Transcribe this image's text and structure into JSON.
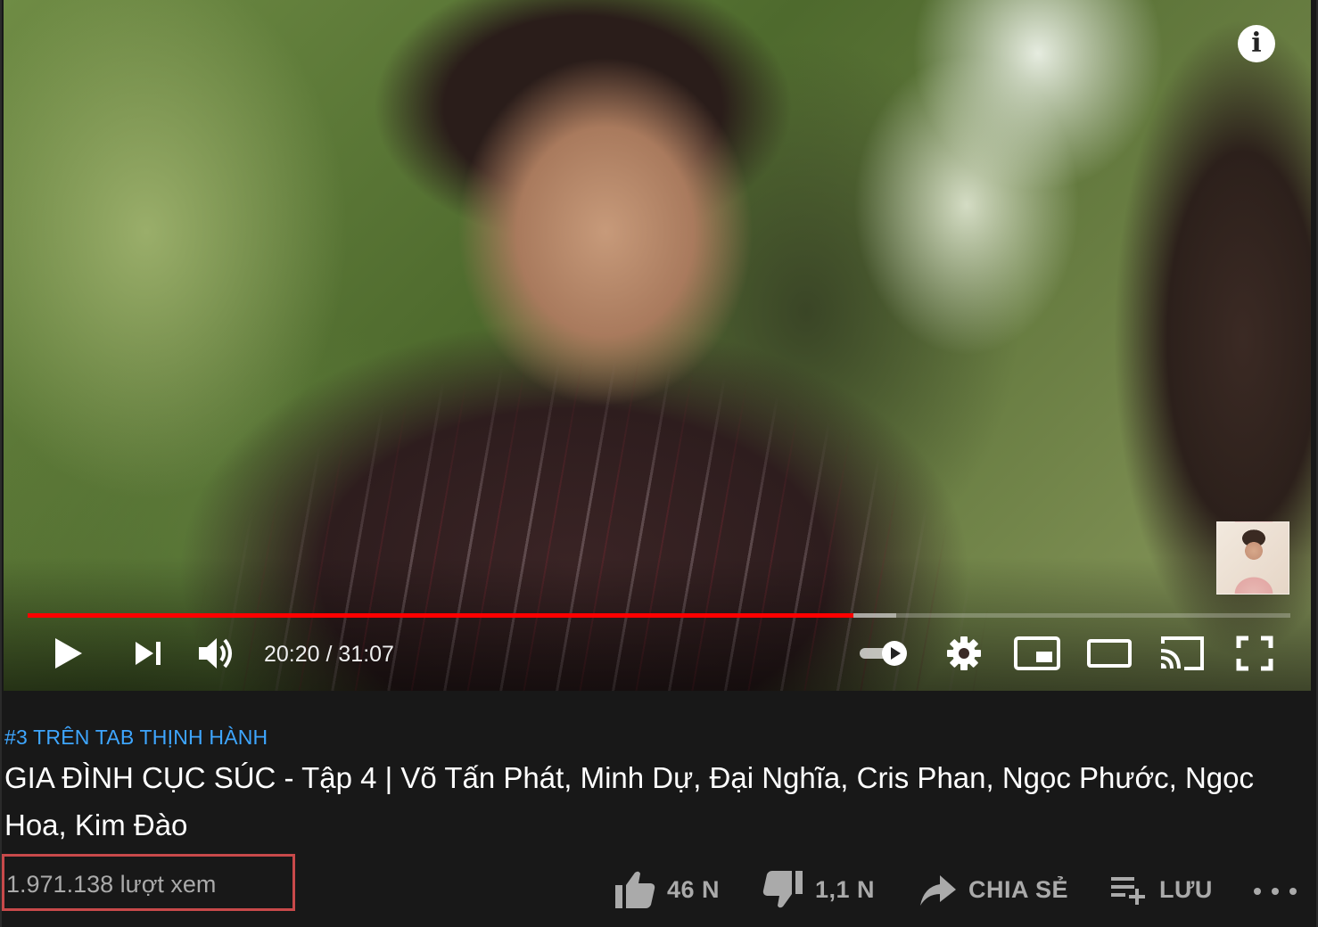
{
  "player": {
    "current_time": "20:20",
    "duration": "31:07",
    "time_display": "20:20 / 31:07",
    "progress_played_fraction": 0.654,
    "progress_buffered_fraction": 0.688,
    "autoplay": true,
    "controls": [
      "play-icon",
      "next-icon",
      "volume-icon",
      "autoplay-toggle",
      "settings-icon",
      "miniplayer-icon",
      "theater-icon",
      "cast-icon",
      "fullscreen-icon"
    ],
    "info_label": "i"
  },
  "video": {
    "hashtag": "#3 TRÊN TAB THỊNH HÀNH",
    "title": "GIA ĐÌNH CỤC SÚC - Tập 4 | Võ Tấn Phát, Minh Dự, Đại Nghĩa, Cris Phan, Ngọc Phước, Ngọc Hoa, Kim Đào",
    "views": "1.971.138 lượt xem"
  },
  "actions": {
    "like_count": "46 N",
    "dislike_count": "1,1 N",
    "share_label": "CHIA SẺ",
    "save_label": "LƯU"
  },
  "colors": {
    "progress": "#ff0000",
    "hashtag": "#3ea6ff",
    "highlight_box": "#c8494a",
    "background": "#181818"
  }
}
